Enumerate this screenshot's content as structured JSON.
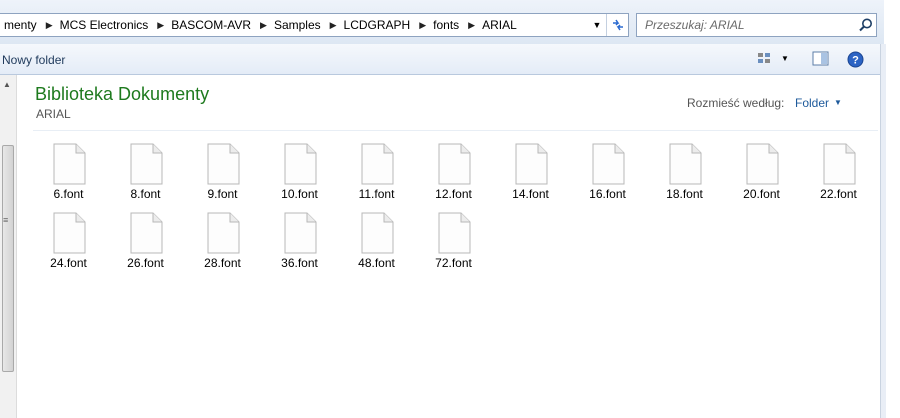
{
  "address_bar": {
    "breadcrumbs": [
      "menty",
      "MCS Electronics",
      "BASCOM-AVR",
      "Samples",
      "LCDGRAPH",
      "fonts",
      "ARIAL"
    ]
  },
  "search": {
    "placeholder": "Przeszukaj: ARIAL"
  },
  "toolbar": {
    "new_folder_label": "Nowy folder"
  },
  "library": {
    "title": "Biblioteka Dokumenty",
    "subtitle": "ARIAL",
    "arrange_label": "Rozmieść według:",
    "arrange_value": "Folder"
  },
  "files": [
    {
      "name": "6.font"
    },
    {
      "name": "8.font"
    },
    {
      "name": "9.font"
    },
    {
      "name": "10.font"
    },
    {
      "name": "11.font"
    },
    {
      "name": "12.font"
    },
    {
      "name": "14.font"
    },
    {
      "name": "16.font"
    },
    {
      "name": "18.font"
    },
    {
      "name": "20.font"
    },
    {
      "name": "22.font"
    },
    {
      "name": "24.font"
    },
    {
      "name": "26.font"
    },
    {
      "name": "28.font"
    },
    {
      "name": "36.font"
    },
    {
      "name": "48.font"
    },
    {
      "name": "72.font"
    }
  ],
  "icons": {
    "refresh": "refresh-icon",
    "search": "search-icon",
    "views": "change-view-icon",
    "preview": "preview-pane-icon",
    "help": "help-icon",
    "file": "generic-file-icon"
  },
  "colors": {
    "library_title": "#1e7a1e",
    "link": "#1e5a9b",
    "help": "#2b63c4"
  }
}
